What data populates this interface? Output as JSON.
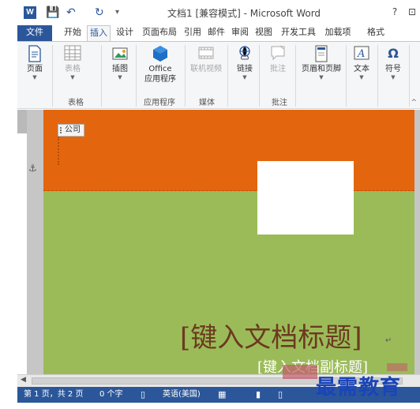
{
  "app": {
    "title": "文档1 [兼容模式] - Microsoft Word",
    "logo_letter": "W",
    "qa_save_glyph": "💾",
    "qa_undo_glyph": "↶",
    "qa_redo_glyph": "↻",
    "qa_more_glyph": "▾",
    "help_glyph": "?",
    "restore_glyph": "⊡"
  },
  "tabs": [
    {
      "label": "文件"
    },
    {
      "label": "开始"
    },
    {
      "label": "插入"
    },
    {
      "label": "设计"
    },
    {
      "label": "页面布局"
    },
    {
      "label": "引用"
    },
    {
      "label": "邮件"
    },
    {
      "label": "审阅"
    },
    {
      "label": "视图"
    },
    {
      "label": "开发工具"
    },
    {
      "label": "加载项"
    },
    {
      "label": "格式"
    }
  ],
  "ribbon": {
    "page": {
      "label": "页面",
      "icon": "page-icon"
    },
    "table": {
      "label": "表格",
      "icon": "table-icon"
    },
    "table_group": "表格",
    "illustrations": {
      "label": "插图",
      "icon": "illustrations-icon"
    },
    "office_apps": {
      "label1": "Office",
      "label2": "应用程序",
      "icon": "office-icon"
    },
    "apps_group": "应用程序",
    "online_video": {
      "label": "联机视频",
      "icon": "video-icon"
    },
    "media_group": "媒体",
    "links": {
      "label": "链接",
      "icon": "link-icon"
    },
    "comment": {
      "label": "批注",
      "icon": "comment-icon"
    },
    "comment_group": "批注",
    "header_footer": {
      "label": "页眉和页脚",
      "icon": "header-footer-icon"
    },
    "text": {
      "label": "文本",
      "icon": "text-icon"
    },
    "symbol": {
      "label": "符号",
      "icon": "omega-icon"
    },
    "collapse_glyph": "^"
  },
  "document": {
    "company_field": "公司",
    "title_placeholder": "[键入文档标题]",
    "subtitle_placeholder": "[键入文档副标题]",
    "return_mark": "↵",
    "anchor_glyph": "⚓",
    "colors": {
      "orange": "#e3660f",
      "green": "#9bbb59",
      "title": "#6b3a1f"
    }
  },
  "scrollbar": {
    "left_arrow": "◀"
  },
  "status": {
    "page": "第 1 页，共 2 页",
    "words": "0 个字",
    "proofing_glyph": "▯",
    "language": "英语(美国)",
    "macro_glyph": "▦",
    "read_glyph": "▮",
    "print_glyph": "▯"
  },
  "watermark": "最需教育"
}
